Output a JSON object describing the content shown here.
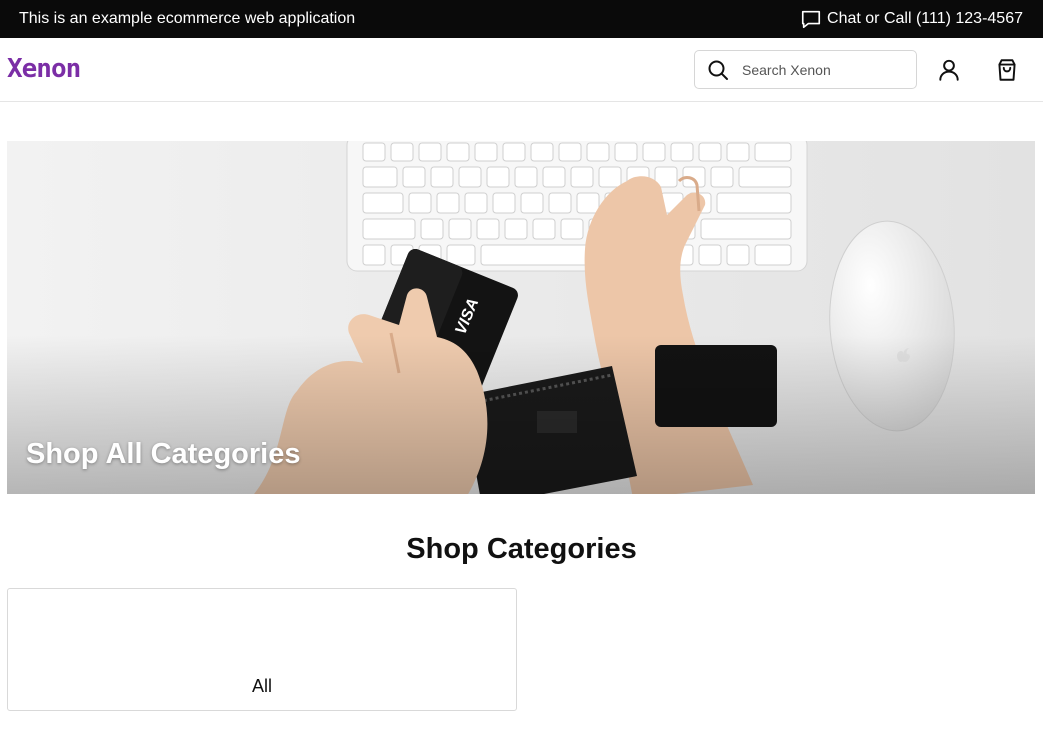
{
  "announcement": {
    "text": "This is an example ecommerce web application",
    "contact": "Chat or Call (111) 123-4567",
    "contact_icon": "chat-bubble-icon"
  },
  "header": {
    "logo": "Xenon",
    "search_placeholder": "Search Xenon",
    "search_icon": "search-icon",
    "account_icon": "user-icon",
    "cart_icon": "shopping-bag-icon"
  },
  "hero": {
    "title": "Shop All Categories",
    "image": "desk-keyboard-mouse-credit-card-photo"
  },
  "categories": {
    "heading": "Shop Categories",
    "items": [
      {
        "label": "All"
      }
    ]
  },
  "colors": {
    "announcement_bg": "#0a0a0a",
    "logo": "#7b2ea6"
  }
}
